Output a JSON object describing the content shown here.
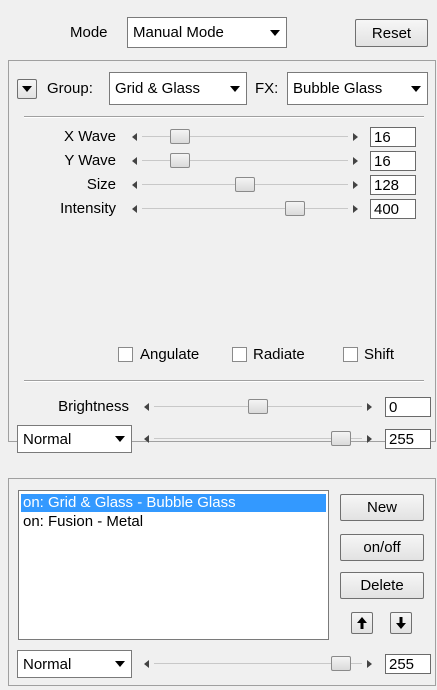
{
  "mode": {
    "label": "Mode",
    "value": "Manual Mode",
    "reset_label": "Reset"
  },
  "effect": {
    "group_label": "Group:",
    "group_value": "Grid & Glass",
    "fx_label": "FX:",
    "fx_value": "Bubble Glass"
  },
  "params": [
    {
      "label": "X Wave",
      "value": "16",
      "level": 0.15
    },
    {
      "label": "Y Wave",
      "value": "16",
      "level": 0.15
    },
    {
      "label": "Size",
      "value": "128",
      "level": 0.5
    },
    {
      "label": "Intensity",
      "value": "400",
      "level": 0.77
    }
  ],
  "checkboxes": [
    {
      "label": "Angulate",
      "checked": false
    },
    {
      "label": "Radiate",
      "checked": false
    },
    {
      "label": "Shift",
      "checked": false
    }
  ],
  "brightness": {
    "label": "Brightness",
    "value": "0",
    "level": 0.5
  },
  "blend": {
    "mode": "Normal",
    "value": "255",
    "level": 0.94
  },
  "layers": {
    "items": [
      {
        "text": "on:  Grid & Glass - Bubble Glass",
        "selected": true
      },
      {
        "text": "on:  Fusion - Metal",
        "selected": false
      }
    ],
    "new_label": "New",
    "onoff_label": "on/off",
    "delete_label": "Delete",
    "up_icon": "arrow-up-icon",
    "down_icon": "arrow-down-icon",
    "blend_mode": "Normal",
    "blend_value": "255",
    "blend_level": 0.94
  },
  "colors": {
    "selection": "#3399ff",
    "background": "#f0f0f0"
  }
}
